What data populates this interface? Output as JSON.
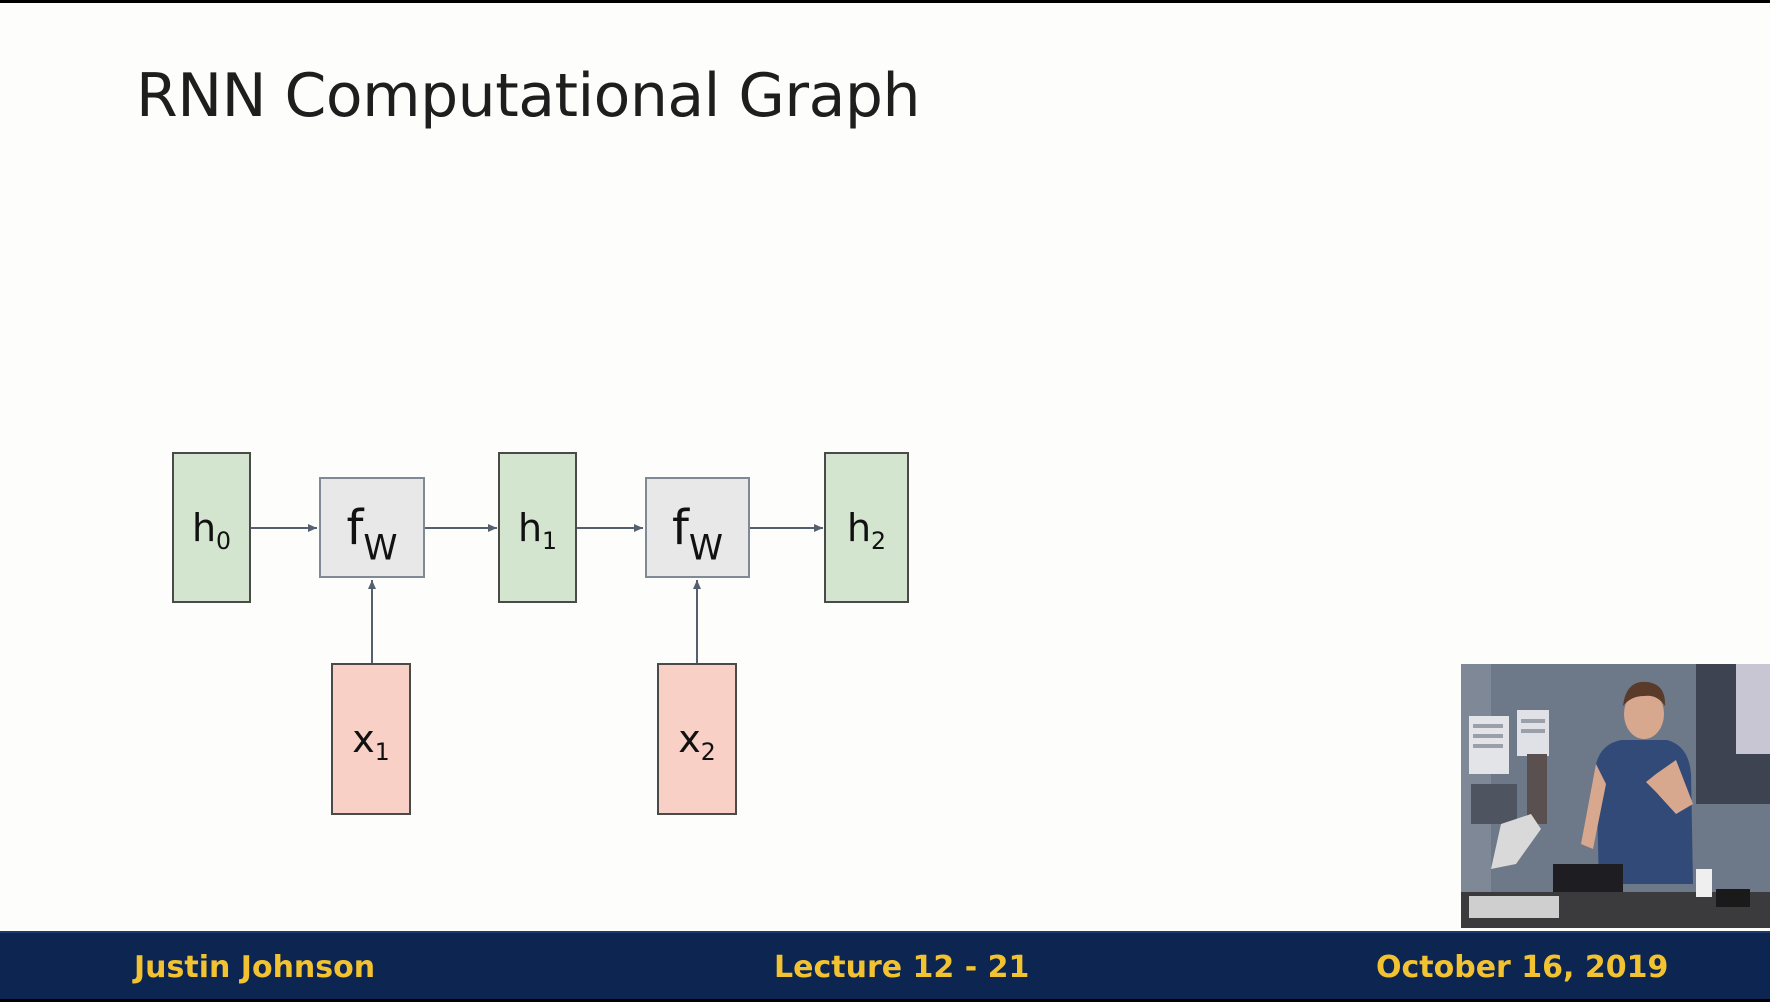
{
  "slide": {
    "title": "RNN Computational Graph"
  },
  "diagram": {
    "nodes": [
      {
        "id": "h0",
        "base": "h",
        "sub": "0",
        "type": "hidden",
        "color": "#d3e5cf"
      },
      {
        "id": "fw1",
        "base": "f",
        "sub": "W",
        "type": "function",
        "color": "#e8e8e8"
      },
      {
        "id": "h1",
        "base": "h",
        "sub": "1",
        "type": "hidden",
        "color": "#d3e5cf"
      },
      {
        "id": "fw2",
        "base": "f",
        "sub": "W",
        "type": "function",
        "color": "#e8e8e8"
      },
      {
        "id": "h2",
        "base": "h",
        "sub": "2",
        "type": "hidden",
        "color": "#d3e5cf"
      },
      {
        "id": "x1",
        "base": "x",
        "sub": "1",
        "type": "input",
        "color": "#f8d0c6"
      },
      {
        "id": "x2",
        "base": "x",
        "sub": "2",
        "type": "input",
        "color": "#f8d0c6"
      }
    ],
    "edges": [
      {
        "from": "h0",
        "to": "fw1"
      },
      {
        "from": "fw1",
        "to": "h1"
      },
      {
        "from": "h1",
        "to": "fw2"
      },
      {
        "from": "fw2",
        "to": "h2"
      },
      {
        "from": "x1",
        "to": "fw1"
      },
      {
        "from": "x2",
        "to": "fw2"
      }
    ]
  },
  "footer": {
    "left": "Justin Johnson",
    "center": "Lecture 12 - 21",
    "right": "October 16, 2019",
    "background": "#0d2651",
    "text_color": "#f2c230"
  },
  "video_overlay": {
    "description_icon": "presenter-video-icon"
  }
}
